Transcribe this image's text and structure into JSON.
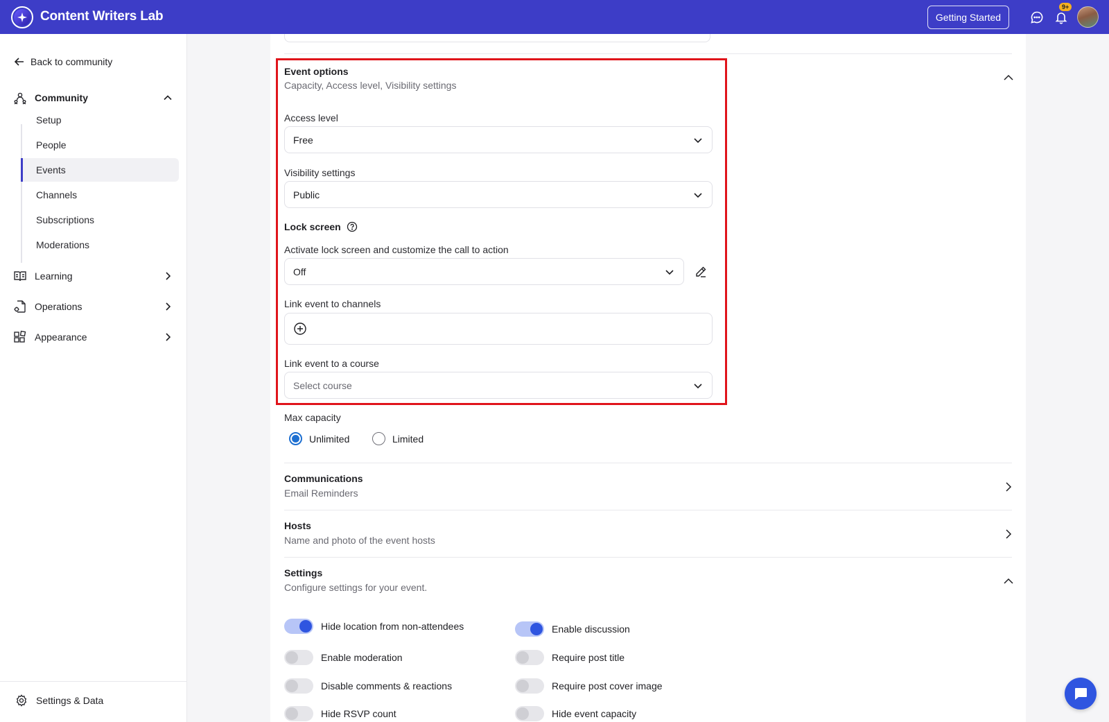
{
  "app": {
    "title": "Content Writers Lab"
  },
  "topbar": {
    "getting_started": "Getting Started",
    "notification_badge": "9+"
  },
  "sidebar": {
    "back": "Back to community",
    "community": "Community",
    "items": [
      "Setup",
      "People",
      "Events",
      "Channels",
      "Subscriptions",
      "Moderations"
    ],
    "active_item": "Events",
    "learning": "Learning",
    "operations": "Operations",
    "appearance": "Appearance",
    "settings_data": "Settings & Data"
  },
  "event_options": {
    "title": "Event options",
    "subtitle": "Capacity, Access level, Visibility settings",
    "access_level_label": "Access level",
    "access_level_value": "Free",
    "visibility_label": "Visibility settings",
    "visibility_value": "Public",
    "lock_screen_title": "Lock screen",
    "lock_screen_label": "Activate lock screen and customize the call to action",
    "lock_screen_value": "Off",
    "link_channels_label": "Link event to channels",
    "link_course_label": "Link event to a course",
    "link_course_placeholder": "Select course",
    "max_capacity_label": "Max capacity",
    "capacity_options": [
      "Unlimited",
      "Limited"
    ],
    "capacity_selected": "Unlimited"
  },
  "communications": {
    "title": "Communications",
    "subtitle": "Email Reminders"
  },
  "hosts": {
    "title": "Hosts",
    "subtitle": "Name and photo of the event hosts"
  },
  "settings": {
    "title": "Settings",
    "subtitle": "Configure settings for your event.",
    "toggles_left": [
      {
        "label": "Hide location from non-attendees",
        "on": true
      },
      {
        "label": "Enable moderation",
        "on": false
      },
      {
        "label": "Disable comments & reactions",
        "on": false
      },
      {
        "label": "Hide RSVP count",
        "on": false
      }
    ],
    "toggles_right": [
      {
        "label": "Enable discussion",
        "on": true
      },
      {
        "label": "Require post title",
        "on": false
      },
      {
        "label": "Require post cover image",
        "on": false
      },
      {
        "label": "Hide event capacity",
        "on": false
      }
    ]
  },
  "colors": {
    "brand": "#3d3dc7",
    "accent": "#2f55e0",
    "highlight": "#e0141b",
    "radio": "#1d6fd1"
  }
}
